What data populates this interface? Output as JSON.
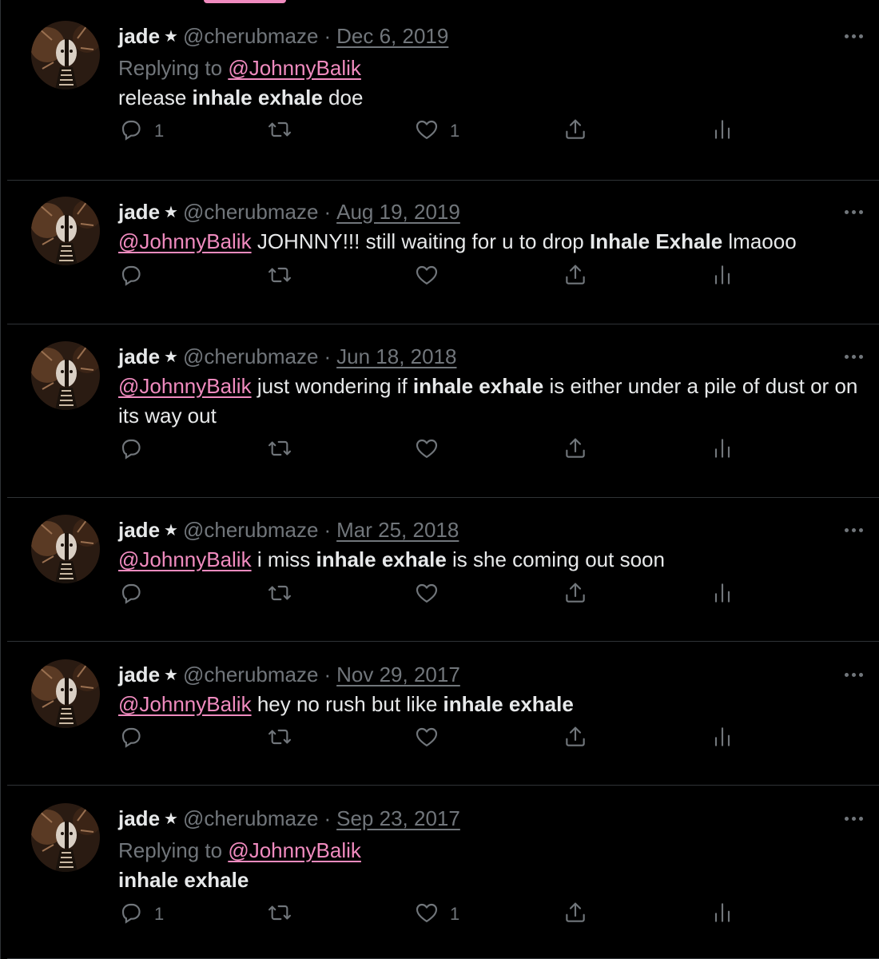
{
  "accent_color": "#f08bbf",
  "tweets": [
    {
      "name": "jade",
      "handle": "@cherubmaze",
      "date": "Dec 6, 2019",
      "replying_prefix": "Replying to",
      "replying_to": "@JohnnyBalik",
      "text": [
        {
          "t": "release "
        },
        {
          "t": "inhale exhale",
          "b": true
        },
        {
          "t": " doe"
        }
      ],
      "reply_count": "1",
      "retweet_count": "",
      "like_count": "1"
    },
    {
      "name": "jade",
      "handle": "@cherubmaze",
      "date": "Aug 19, 2019",
      "text": [
        {
          "t": "@JohnnyBalik",
          "m": true
        },
        {
          "t": " JOHNNY!!! still waiting for u to drop "
        },
        {
          "t": "Inhale Exhale",
          "b": true
        },
        {
          "t": " lmaooo"
        }
      ],
      "reply_count": "",
      "retweet_count": "",
      "like_count": ""
    },
    {
      "name": "jade",
      "handle": "@cherubmaze",
      "date": "Jun 18, 2018",
      "text": [
        {
          "t": "@JohnnyBalik",
          "m": true
        },
        {
          "t": " just wondering if "
        },
        {
          "t": "inhale exhale",
          "b": true
        },
        {
          "t": " is either under a pile of dust or on its way out"
        }
      ],
      "reply_count": "",
      "retweet_count": "",
      "like_count": ""
    },
    {
      "name": "jade",
      "handle": "@cherubmaze",
      "date": "Mar 25, 2018",
      "text": [
        {
          "t": "@JohnnyBalik",
          "m": true
        },
        {
          "t": " i miss "
        },
        {
          "t": "inhale exhale",
          "b": true
        },
        {
          "t": " is she coming out soon"
        }
      ],
      "reply_count": "",
      "retweet_count": "",
      "like_count": ""
    },
    {
      "name": "jade",
      "handle": "@cherubmaze",
      "date": "Nov 29, 2017",
      "text": [
        {
          "t": "@JohnnyBalik",
          "m": true
        },
        {
          "t": " hey no rush but like "
        },
        {
          "t": "inhale exhale",
          "b": true
        }
      ],
      "reply_count": "",
      "retweet_count": "",
      "like_count": ""
    },
    {
      "name": "jade",
      "handle": "@cherubmaze",
      "date": "Sep 23, 2017",
      "replying_prefix": "Replying to",
      "replying_to": "@JohnnyBalik",
      "text": [
        {
          "t": "inhale exhale",
          "b": true
        }
      ],
      "reply_count": "1",
      "retweet_count": "",
      "like_count": "1"
    }
  ]
}
